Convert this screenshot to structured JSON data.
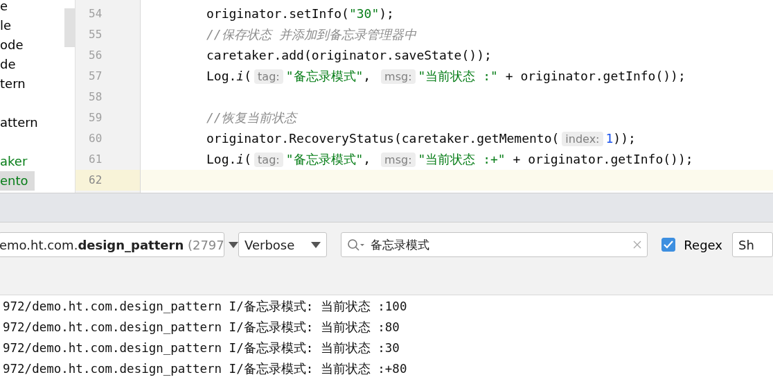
{
  "project_tree": {
    "groups": [
      {
        "items": [
          {
            "label": "e",
            "color": "#000000",
            "selected": false
          },
          {
            "label": "le",
            "color": "#000000",
            "selected": false
          },
          {
            "label": "ode",
            "color": "#000000",
            "selected": false
          },
          {
            "label": "de",
            "color": "#000000",
            "selected": false
          },
          {
            "label": "tern",
            "color": "#000000",
            "selected": false
          }
        ]
      },
      {
        "items": [
          {
            "label": "attern",
            "color": "#000000",
            "selected": false
          }
        ]
      },
      {
        "items": [
          {
            "label": "aker",
            "color": "#067d17",
            "selected": false
          },
          {
            "label": "ento",
            "color": "#067d17",
            "selected": true
          }
        ]
      }
    ]
  },
  "editor": {
    "lines": [
      {
        "number": "54",
        "current": false,
        "tokens": [
          {
            "kind": "plain",
            "text": "originator.setInfo("
          },
          {
            "kind": "string",
            "text": "\"30\""
          },
          {
            "kind": "plain",
            "text": ");"
          }
        ]
      },
      {
        "number": "55",
        "current": false,
        "tokens": [
          {
            "kind": "comment",
            "text": "//保存状态 并添加到备忘录管理器中"
          }
        ]
      },
      {
        "number": "56",
        "current": false,
        "tokens": [
          {
            "kind": "plain",
            "text": "caretaker.add(originator.saveState());"
          }
        ]
      },
      {
        "number": "57",
        "current": false,
        "tokens": [
          {
            "kind": "plain",
            "text": "Log."
          },
          {
            "kind": "italic",
            "text": "i"
          },
          {
            "kind": "plain",
            "text": "("
          },
          {
            "kind": "hint",
            "text": "tag:"
          },
          {
            "kind": "string",
            "text": "\"备忘录模式\""
          },
          {
            "kind": "plain",
            "text": ", "
          },
          {
            "kind": "hint",
            "text": "msg:"
          },
          {
            "kind": "string",
            "text": "\"当前状态 :\""
          },
          {
            "kind": "plain",
            "text": " + originator.getInfo());"
          }
        ]
      },
      {
        "number": "58",
        "current": false
      },
      {
        "number": "59",
        "current": false,
        "tokens": [
          {
            "kind": "comment",
            "text": "//恢复当前状态"
          }
        ]
      },
      {
        "number": "60",
        "current": false,
        "tokens": [
          {
            "kind": "plain",
            "text": "originator.RecoveryStatus(caretaker.getMemento("
          },
          {
            "kind": "hint",
            "text": "index:"
          },
          {
            "kind": "number",
            "text": "1"
          },
          {
            "kind": "plain",
            "text": "));"
          }
        ]
      },
      {
        "number": "61",
        "current": false,
        "tokens": [
          {
            "kind": "plain",
            "text": "Log."
          },
          {
            "kind": "italic",
            "text": "i"
          },
          {
            "kind": "plain",
            "text": "("
          },
          {
            "kind": "hint",
            "text": "tag:"
          },
          {
            "kind": "string",
            "text": "\"备忘录模式\""
          },
          {
            "kind": "plain",
            "text": ", "
          },
          {
            "kind": "hint",
            "text": "msg:"
          },
          {
            "kind": "string",
            "text": "\"当前状态 :+\""
          },
          {
            "kind": "plain",
            "text": " + originator.getInfo());"
          }
        ]
      },
      {
        "number": "62",
        "current": true
      }
    ]
  },
  "logcat_toolbar": {
    "process": {
      "package": "emo.ht.com.",
      "app": "design_pattern",
      "pid": " (2797"
    },
    "level": "Verbose",
    "search": {
      "value": "备忘录模式"
    },
    "regex": {
      "label": "Regex",
      "checked": true
    },
    "next_button": "Sh"
  },
  "log_lines": [
    "972/demo.ht.com.design_pattern I/备忘录模式: 当前状态 :100",
    "972/demo.ht.com.design_pattern I/备忘录模式: 当前状态 :80",
    "972/demo.ht.com.design_pattern I/备忘录模式: 当前状态 :30",
    "972/demo.ht.com.design_pattern I/备忘录模式: 当前状态 :+80"
  ]
}
